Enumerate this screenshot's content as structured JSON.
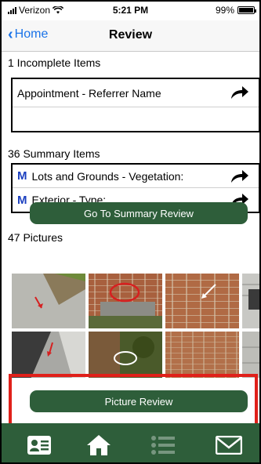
{
  "status_bar": {
    "carrier": "Verizon",
    "time": "5:21 PM",
    "battery": "99%",
    "battery_level": 0.99
  },
  "nav": {
    "back_label": "Home",
    "title": "Review"
  },
  "incomplete": {
    "header": "1 Incomplete Items",
    "items": [
      {
        "label": "Appointment - Referrer Name"
      }
    ]
  },
  "summary": {
    "header": "36 Summary Items",
    "items": [
      {
        "marker": "M",
        "label": "Lots and Grounds - Vegetation:"
      },
      {
        "marker": "M",
        "label": "Exterior - Type:"
      }
    ],
    "button_label": "Go To Summary Review"
  },
  "pictures": {
    "header": "47 Pictures",
    "button_label": "Picture Review"
  },
  "tab_bar": {
    "tabs": [
      {
        "icon": "contact-card-icon"
      },
      {
        "icon": "home-icon"
      },
      {
        "icon": "list-icon"
      },
      {
        "icon": "mail-icon"
      }
    ]
  },
  "colors": {
    "accent": "#2e5e3a",
    "link": "#1a73e8",
    "marker": "#1b3fbf",
    "highlight": "#e0201a"
  }
}
